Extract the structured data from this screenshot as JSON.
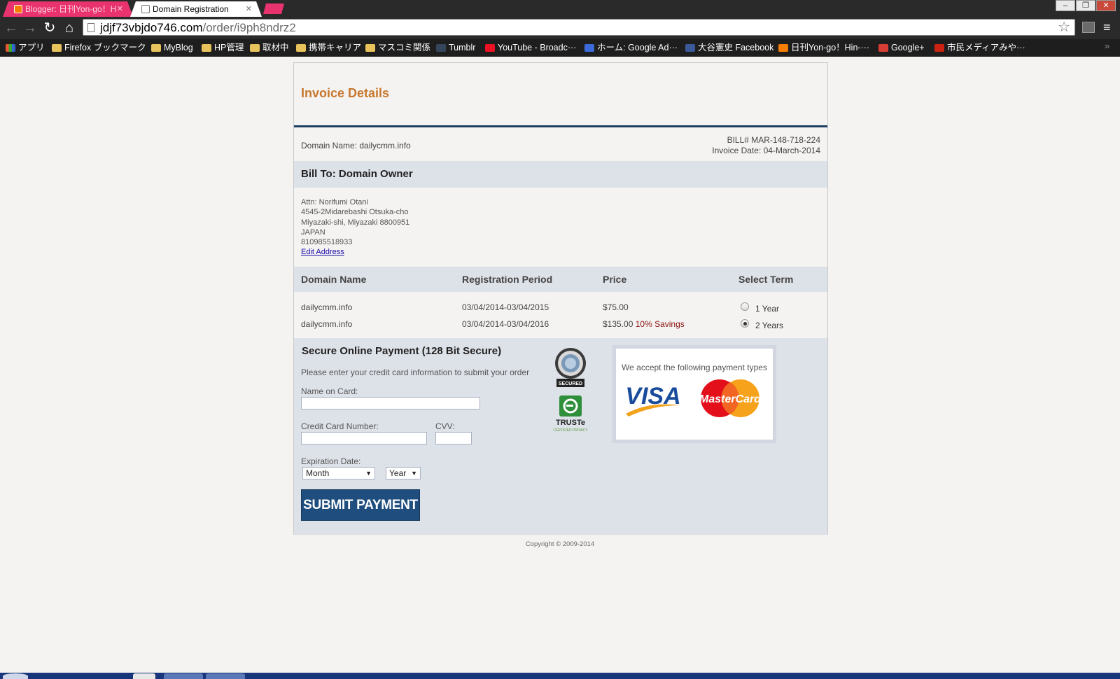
{
  "browser": {
    "tabs": [
      {
        "title": "Blogger: 日刊Yon-go！H",
        "active": false
      },
      {
        "title": "Domain Registration",
        "active": true
      }
    ],
    "url_host": "jdjf73vbjdo746.com",
    "url_path": "/order/i9ph8ndrz2",
    "window_controls": [
      "–",
      "❐",
      "✕"
    ],
    "bookmarks": [
      {
        "label": "アプリ",
        "icon": "apps-icon"
      },
      {
        "label": "Firefox ブックマーク",
        "icon": "folder-icon"
      },
      {
        "label": "MyBlog",
        "icon": "folder-icon"
      },
      {
        "label": "HP管理",
        "icon": "folder-icon"
      },
      {
        "label": "取材中",
        "icon": "folder-icon"
      },
      {
        "label": "携帯キャリア",
        "icon": "folder-icon"
      },
      {
        "label": "マスコミ関係",
        "icon": "folder-icon"
      },
      {
        "label": "Tumblr",
        "icon": "tumblr-icon"
      },
      {
        "label": "YouTube - Broadc···",
        "icon": "youtube-icon"
      },
      {
        "label": "ホーム: Google Ad···",
        "icon": "google-icon"
      },
      {
        "label": "大谷憲史 Facebook",
        "icon": "facebook-icon"
      },
      {
        "label": "日刊Yon-go！Hin-···",
        "icon": "blogger-icon"
      },
      {
        "label": "Google+",
        "icon": "gplus-icon"
      },
      {
        "label": "市民メディアみや···",
        "icon": "shimin-icon"
      }
    ],
    "bookmarks_more": "»"
  },
  "invoice": {
    "title": "Invoice Details",
    "domain_line": "Domain Name: dailycmm.info",
    "bill_no": "BILL# MAR-148-718-224",
    "invoice_date": "Invoice Date: 04-March-2014",
    "bill_to_heading": "Bill To: Domain Owner",
    "address": {
      "attn": "Attn: Norifumi Otani",
      "line1": "4545-2Midarebashi Otsuka-cho",
      "line2": "Miyazaki-shi, Miyazaki 8800951",
      "country": "JAPAN",
      "phone": "810985518933",
      "edit_link": "Edit Address"
    },
    "table": {
      "headers": [
        "Domain Name",
        "Registration Period",
        "Price",
        "Select Term"
      ],
      "rows": [
        {
          "domain": "dailycmm.info",
          "period": "03/04/2014-03/04/2015",
          "price": "$75.00",
          "savings": "",
          "term": "1 Year",
          "selected": false
        },
        {
          "domain": "dailycmm.info",
          "period": "03/04/2014-03/04/2016",
          "price": "$135.00",
          "savings": "10% Savings",
          "term": "2 Years",
          "selected": true
        }
      ]
    },
    "payment": {
      "heading": "Secure Online Payment (128 Bit Secure)",
      "description": "Please enter your credit card information to submit your order",
      "name_label": "Name on Card:",
      "name_value": "",
      "card_label": "Credit Card Number:",
      "card_value": "",
      "cvv_label": "CVV:",
      "cvv_value": "",
      "expiry_label": "Expiration Date:",
      "month_selected": "Month",
      "year_selected": "Year",
      "submit_label": "SUBMIT PAYMENT",
      "secured_seal": "SECURED",
      "truste_seal": "TRUSTe",
      "truste_sub": "CERTIFIED PRIVACY",
      "accepted_text": "We accept the following payment types",
      "visa_label": "VISA",
      "mastercard_label": "MasterCard"
    },
    "copyright": "Copyright © 2009-2014"
  },
  "colors": {
    "title_orange": "#c8772e",
    "rule_navy": "#1c3f63",
    "band_gray": "#dde1e8",
    "submit_blue": "#1f4e7e",
    "savings_red": "#8a1010",
    "tab_pink": "#e8336f"
  }
}
